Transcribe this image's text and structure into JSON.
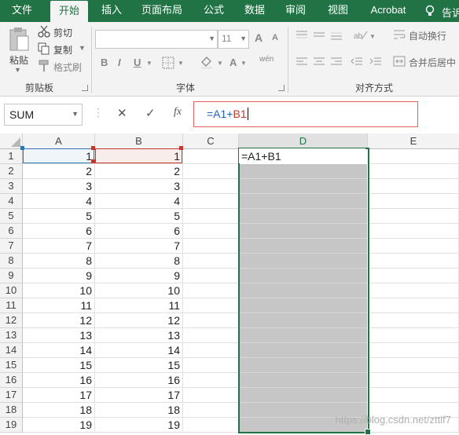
{
  "tabs": [
    {
      "label": "文件",
      "active": false
    },
    {
      "label": "开始",
      "active": true
    },
    {
      "label": "插入",
      "active": false
    },
    {
      "label": "页面布局",
      "active": false
    },
    {
      "label": "公式",
      "active": false
    },
    {
      "label": "数据",
      "active": false
    },
    {
      "label": "审阅",
      "active": false
    },
    {
      "label": "视图",
      "active": false
    },
    {
      "label": "Acrobat",
      "active": false
    },
    {
      "label": "告诉",
      "active": false
    }
  ],
  "clipboard": {
    "paste": "粘贴",
    "cut": "剪切",
    "copy": "复制",
    "format_painter": "格式刷",
    "group_label": "剪贴板"
  },
  "font": {
    "name_value": "",
    "size_value": "11",
    "group_label": "字体",
    "bold": "B",
    "italic": "I",
    "underline": "U",
    "grow": "A",
    "shrink": "A",
    "color_a": "A",
    "wen": "wén"
  },
  "alignment": {
    "wrap_text": "自动换行",
    "merge_center": "合并后居中",
    "group_label": "对齐方式"
  },
  "formula_bar": {
    "name_box": "SUM",
    "cancel": "✕",
    "enter": "✓",
    "fx": "fx",
    "formula_prefix": "=A1+",
    "formula_ref": "B1"
  },
  "columns": [
    "A",
    "B",
    "C",
    "D",
    "E"
  ],
  "rows": [
    {
      "row": "1",
      "a": "1",
      "b": "1"
    },
    {
      "row": "2",
      "a": "2",
      "b": "2"
    },
    {
      "row": "3",
      "a": "3",
      "b": "3"
    },
    {
      "row": "4",
      "a": "4",
      "b": "4"
    },
    {
      "row": "5",
      "a": "5",
      "b": "5"
    },
    {
      "row": "6",
      "a": "6",
      "b": "6"
    },
    {
      "row": "7",
      "a": "7",
      "b": "7"
    },
    {
      "row": "8",
      "a": "8",
      "b": "8"
    },
    {
      "row": "9",
      "a": "9",
      "b": "9"
    },
    {
      "row": "10",
      "a": "10",
      "b": "10"
    },
    {
      "row": "11",
      "a": "11",
      "b": "11"
    },
    {
      "row": "12",
      "a": "12",
      "b": "12"
    },
    {
      "row": "13",
      "a": "13",
      "b": "13"
    },
    {
      "row": "14",
      "a": "14",
      "b": "14"
    },
    {
      "row": "15",
      "a": "15",
      "b": "15"
    },
    {
      "row": "16",
      "a": "16",
      "b": "16"
    },
    {
      "row": "17",
      "a": "17",
      "b": "17"
    },
    {
      "row": "18",
      "a": "18",
      "b": "18"
    },
    {
      "row": "19",
      "a": "19",
      "b": "19"
    }
  ],
  "active_cell_text": "=A1+B1",
  "watermark": "https://blog.csdn.net/zttlf7",
  "colors": {
    "brand": "#217346",
    "ref_blue": "#1f5fbf",
    "ref_red": "#c0392b",
    "selection": "#c6c6c6"
  }
}
